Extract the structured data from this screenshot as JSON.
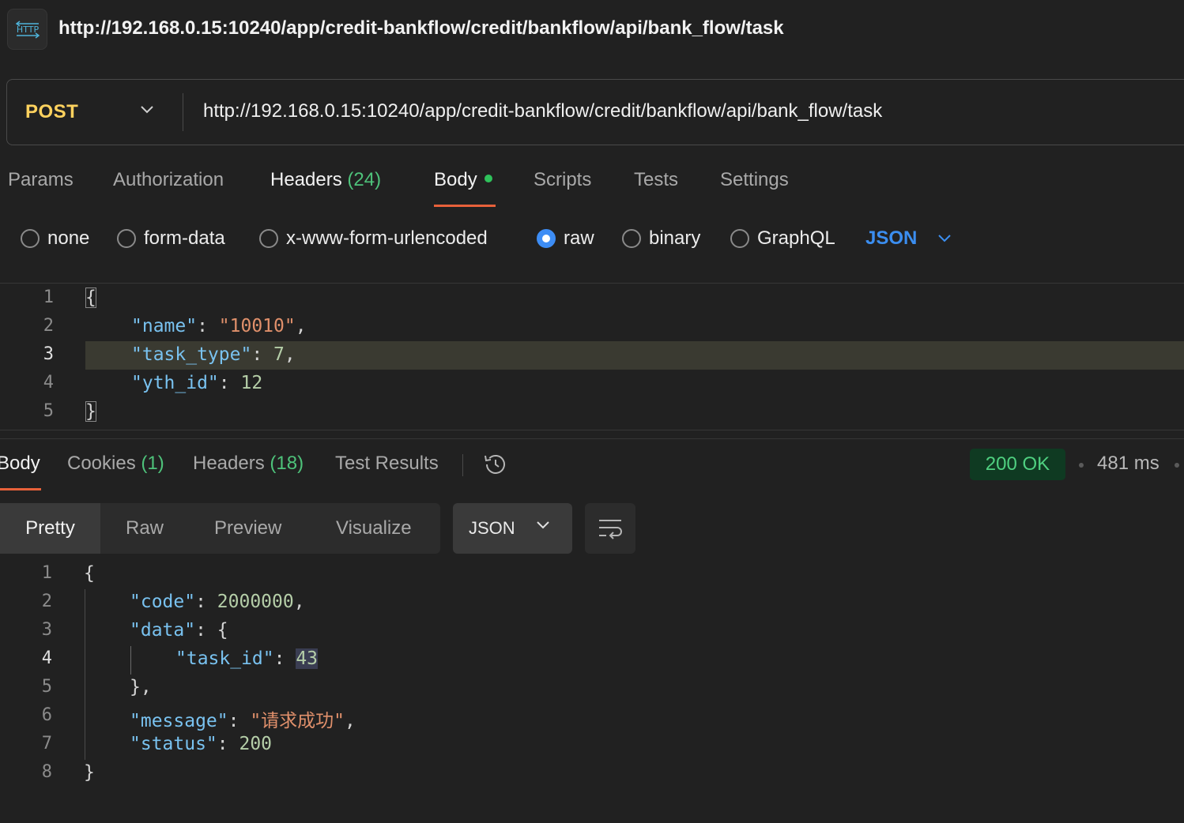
{
  "header": {
    "icon": "http-icon",
    "icon_text": "HTTP",
    "title": "http://192.168.0.15:10240/app/credit-bankflow/credit/bankflow/api/bank_flow/task"
  },
  "request": {
    "method": "POST",
    "url": "http://192.168.0.15:10240/app/credit-bankflow/credit/bankflow/api/bank_flow/task",
    "tabs": {
      "params": "Params",
      "authorization": "Authorization",
      "headers": "Headers",
      "headers_count": "(24)",
      "body": "Body",
      "scripts": "Scripts",
      "tests": "Tests",
      "settings": "Settings",
      "active": "Body"
    },
    "body_types": {
      "none": "none",
      "form_data": "form-data",
      "urlencoded": "x-www-form-urlencoded",
      "raw": "raw",
      "binary": "binary",
      "graphql": "GraphQL",
      "selected": "raw"
    },
    "language": "JSON",
    "editor": {
      "line_numbers": [
        "1",
        "2",
        "3",
        "4",
        "5"
      ],
      "active_line": "3",
      "open_brace": "{",
      "close_brace": "}",
      "k_name": "\"name\"",
      "v_name": "\"10010\"",
      "k_task_type": "\"task_type\"",
      "v_task_type": "7",
      "k_yth_id": "\"yth_id\"",
      "v_yth_id": "12"
    }
  },
  "response": {
    "tabs": {
      "body": "Body",
      "cookies": "Cookies",
      "cookies_count": "(1)",
      "headers": "Headers",
      "headers_count": "(18)",
      "test_results": "Test Results",
      "active": "Body"
    },
    "status": "200 OK",
    "status_color": "#4fd080",
    "time": "481 ms",
    "views": {
      "pretty": "Pretty",
      "raw": "Raw",
      "preview": "Preview",
      "visualize": "Visualize",
      "selected": "Pretty"
    },
    "format": "JSON",
    "editor": {
      "line_numbers": [
        "1",
        "2",
        "3",
        "4",
        "5",
        "6",
        "7",
        "8"
      ],
      "open_brace": "{",
      "close_brace": "}",
      "k_code": "\"code\"",
      "v_code": "2000000",
      "k_data": "\"data\"",
      "k_task_id": "\"task_id\"",
      "v_task_id": "43",
      "data_close": "},",
      "k_message": "\"message\"",
      "v_message": "\"请求成功\"",
      "k_status": "\"status\"",
      "v_status": "200"
    }
  },
  "colors": {
    "accent_tab": "#e8613a",
    "method": "#ffd25e",
    "json_key": "#79c2f0",
    "json_string": "#e0906b",
    "json_number": "#b5cea8",
    "link_blue": "#3b8ef0"
  }
}
